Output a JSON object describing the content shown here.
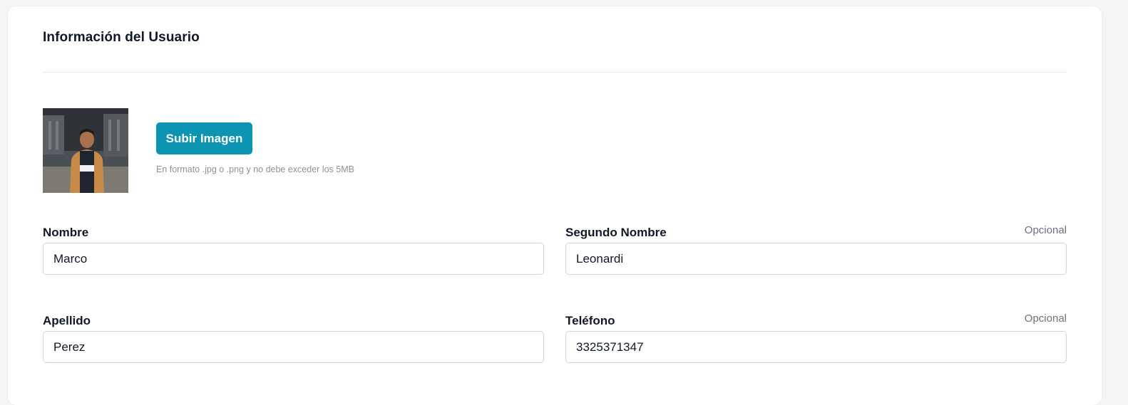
{
  "card": {
    "title": "Información del Usuario"
  },
  "upload": {
    "button_label": "Subir Imagen",
    "hint": "En formato .jpg o .png y no debe exceder los 5MB"
  },
  "fields": {
    "nombre": {
      "label": "Nombre",
      "value": "Marco",
      "optional": ""
    },
    "segundo_nombre": {
      "label": "Segundo Nombre",
      "value": "Leonardi",
      "optional": "Opcional"
    },
    "apellido": {
      "label": "Apellido",
      "value": "Perez",
      "optional": ""
    },
    "telefono": {
      "label": "Teléfono",
      "value": "3325371347",
      "optional": "Opcional"
    }
  },
  "colors": {
    "primary_button": "#0e94b3",
    "background": "#f3f4f6",
    "card": "#ffffff"
  }
}
